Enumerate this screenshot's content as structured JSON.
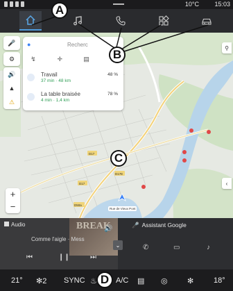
{
  "status_bar": {
    "temperature": "10°C",
    "time": "15:03"
  },
  "top_nav": {
    "tabs": [
      {
        "name": "home",
        "icon": "home-icon"
      },
      {
        "name": "music",
        "icon": "music-note-icon"
      },
      {
        "name": "phone",
        "icon": "phone-icon"
      },
      {
        "name": "apps",
        "icon": "apps-grid-icon"
      },
      {
        "name": "vehicle",
        "icon": "car-icon"
      }
    ],
    "active_tab": "home"
  },
  "search_card": {
    "placeholder": "Recherc",
    "categories": [
      "fuel-icon",
      "restaurant-icon",
      "shopping-cart-icon",
      "more-icon"
    ],
    "destinations": [
      {
        "name": "Travail",
        "detail": "37 min · 48 km",
        "charge": "48 %"
      },
      {
        "name": "La table braisée",
        "detail": "4 min · 1,4 km",
        "charge": "78 %"
      }
    ]
  },
  "map": {
    "route_label": "Rue de Vieux Pont",
    "road_labels": [
      "D17",
      "D17",
      "D17E",
      "D50a"
    ]
  },
  "callouts": [
    "A",
    "B",
    "C",
    "D"
  ],
  "audio_panel": {
    "title": "Audio",
    "track": "Comme l'aigle · Mess",
    "cover_text": "BREAK"
  },
  "assistant_panel": {
    "title": "Assistant Google"
  },
  "climate_bar": {
    "left_temp": "21°",
    "fan_level": "2",
    "sync_label": "SYNC",
    "ac_label": "A/C",
    "right_temp": "18°"
  },
  "colors": {
    "accent": "#4f9bdc",
    "topnav_bg": "#2a2b2e",
    "panel_bg": "#3a3a3c"
  }
}
